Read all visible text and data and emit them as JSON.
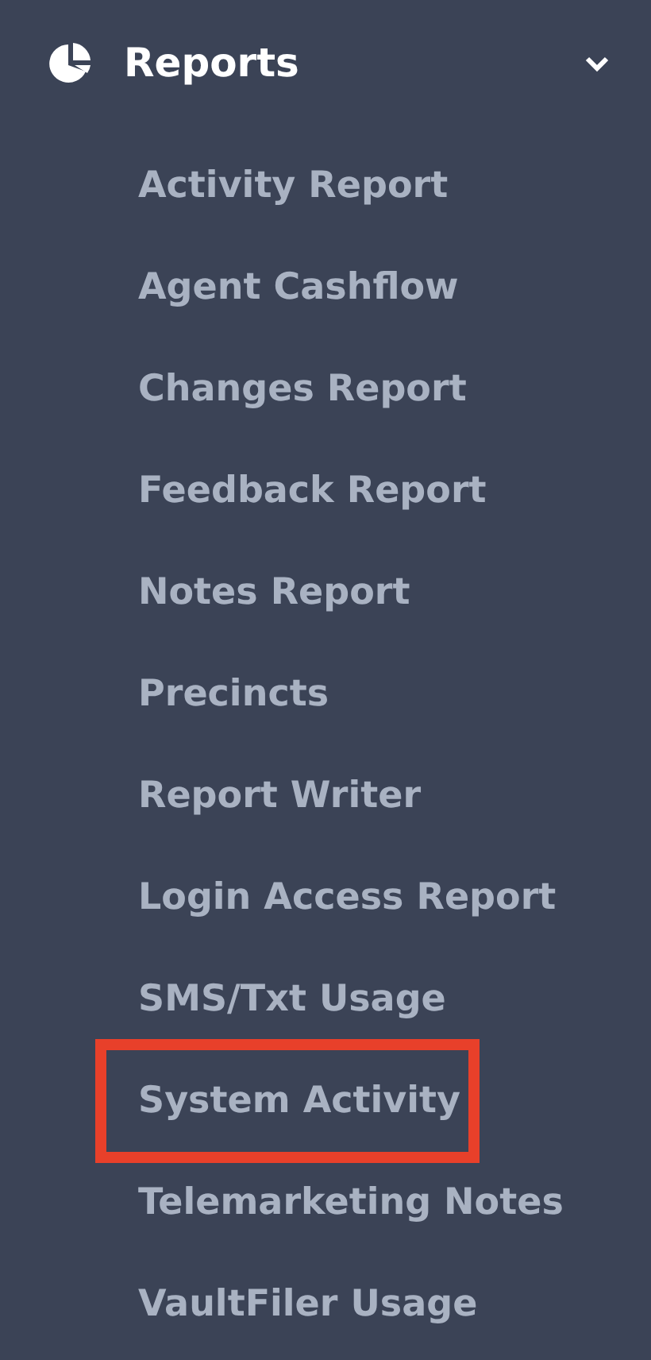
{
  "section": {
    "title": "Reports",
    "expanded": true
  },
  "items": [
    {
      "label": "Activity Report",
      "highlighted": false
    },
    {
      "label": "Agent Cashflow",
      "highlighted": false
    },
    {
      "label": "Changes Report",
      "highlighted": false
    },
    {
      "label": "Feedback Report",
      "highlighted": false
    },
    {
      "label": "Notes Report",
      "highlighted": false
    },
    {
      "label": "Precincts",
      "highlighted": false
    },
    {
      "label": "Report Writer",
      "highlighted": false
    },
    {
      "label": "Login Access Report",
      "highlighted": false
    },
    {
      "label": "SMS/Txt Usage",
      "highlighted": false
    },
    {
      "label": "System Activity",
      "highlighted": true
    },
    {
      "label": "Telemarketing Notes",
      "highlighted": false
    },
    {
      "label": "VaultFiler Usage",
      "highlighted": false
    }
  ]
}
